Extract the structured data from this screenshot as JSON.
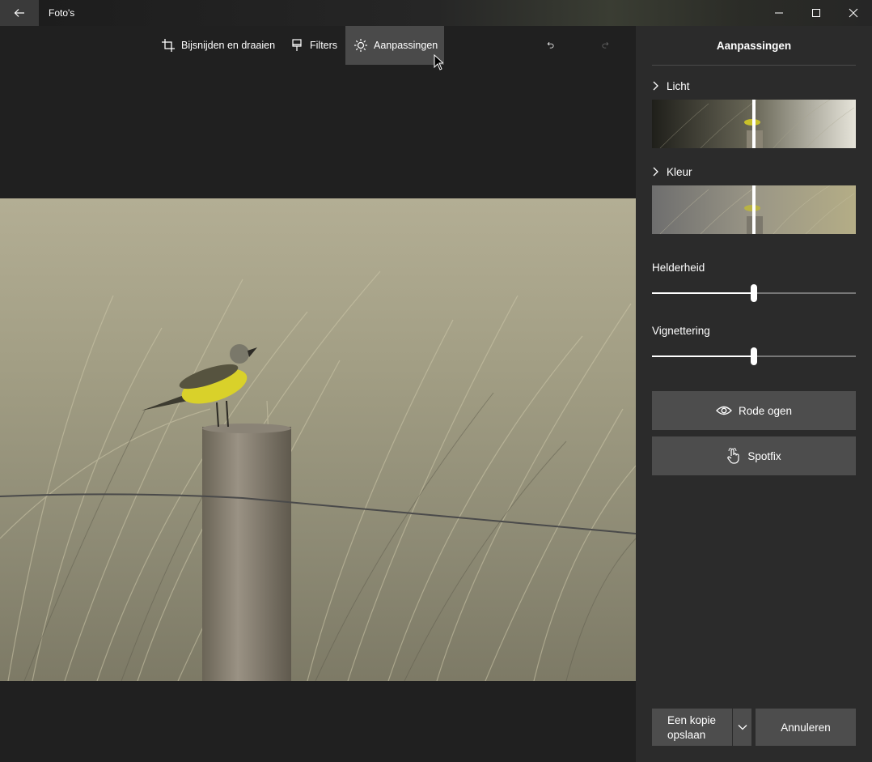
{
  "app": {
    "title": "Foto's"
  },
  "toolbar": {
    "crop_label": "Bijsnijden en draaien",
    "filters_label": "Filters",
    "adjust_label": "Aanpassingen"
  },
  "panel": {
    "title": "Aanpassingen",
    "sections": [
      {
        "label": "Licht"
      },
      {
        "label": "Kleur"
      }
    ],
    "sliders": [
      {
        "label": "Helderheid",
        "value": 0.5
      },
      {
        "label": "Vignettering",
        "value": 0.5
      }
    ],
    "buttons": {
      "red_eye": "Rode ogen",
      "spotfix": "Spotfix"
    },
    "footer": {
      "save_line1": "Een kopie",
      "save_line2": "opslaan",
      "cancel": "Annuleren"
    }
  },
  "colors": {
    "accent_active": "#4a4a4a",
    "panel_bg": "#2b2b2b",
    "canvas_bg": "#202020"
  }
}
